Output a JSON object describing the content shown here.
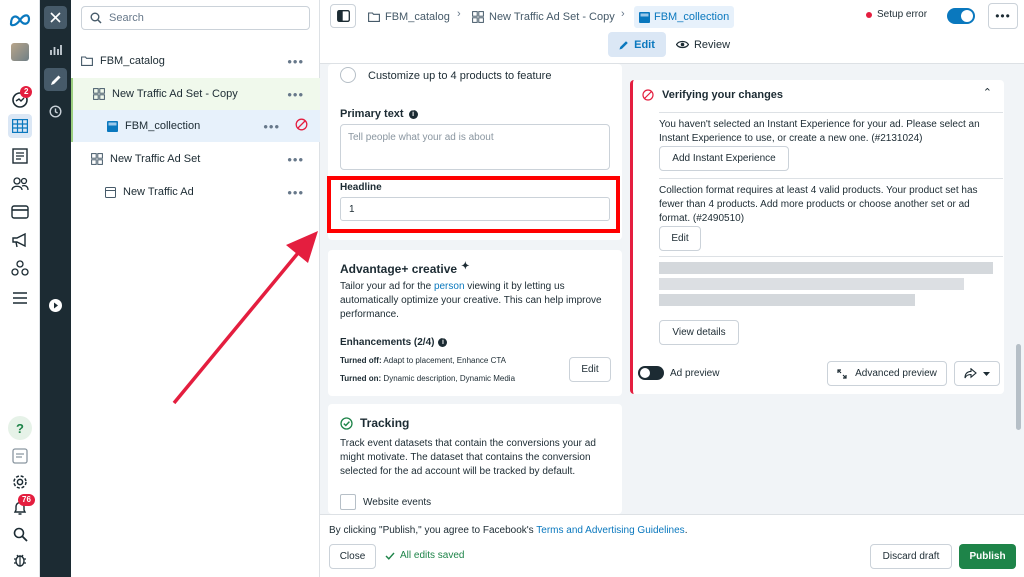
{
  "search": {
    "placeholder": "Search"
  },
  "notifications": {
    "messages_count": "2",
    "alerts_count": "76"
  },
  "tree": {
    "items": [
      {
        "label": "FBM_catalog"
      },
      {
        "label": "New Traffic Ad Set - Copy"
      },
      {
        "label": "FBM_collection"
      },
      {
        "label": "New Traffic Ad Set"
      },
      {
        "label": "New Traffic Ad"
      }
    ]
  },
  "breadcrumb": {
    "items": [
      "FBM_catalog",
      "New Traffic Ad Set - Copy",
      "FBM_collection"
    ]
  },
  "header": {
    "status": "Setup error",
    "tabs": {
      "edit": "Edit",
      "review": "Review"
    }
  },
  "form": {
    "customize_label": "Customize up to 4 products to feature",
    "primary_text": {
      "label": "Primary text",
      "placeholder": "Tell people what your ad is about"
    },
    "headline": {
      "label": "Headline",
      "value": "1"
    },
    "advantage": {
      "title": "Advantage+ creative",
      "desc_before": "Tailor your ad for the ",
      "desc_link": "person",
      "desc_after": " viewing it by letting us automatically optimize your creative. This can help improve performance.",
      "enhancements_label": "Enhancements (2/4)",
      "turned_off_label": "Turned off:",
      "turned_off_value": "Adapt to placement, Enhance CTA",
      "turned_on_label": "Turned on:",
      "turned_on_value": "Dynamic description, Dynamic Media",
      "edit_label": "Edit"
    },
    "tracking": {
      "title": "Tracking",
      "desc": "Track event datasets that contain the conversions your ad might motivate. The dataset that contains the conversion selected for the ad account will be tracked by default.",
      "website_events": "Website events"
    }
  },
  "verify": {
    "title": "Verifying your changes",
    "error1": "You haven't selected an Instant Experience for your ad. Please select an Instant Experience to use, or create a new one. (#2131024)",
    "error1_button": "Add Instant Experience",
    "error2": "Collection format requires at least 4 valid products. Your product set has fewer than 4 products. Add more products or choose another set or ad format. (#2490510)",
    "error2_button": "Edit",
    "view_details": "View details"
  },
  "preview": {
    "toggle_label": "Ad preview",
    "advanced": "Advanced preview"
  },
  "footer": {
    "notice_before": "By clicking \"Publish,\" you agree to Facebook's ",
    "notice_link": "Terms and Advertising Guidelines",
    "notice_after": ".",
    "close": "Close",
    "saved": "All edits saved",
    "discard": "Discard draft",
    "publish": "Publish"
  },
  "colors": {
    "accent": "#0a78be",
    "publish": "#1e8449",
    "error": "#e41e3f",
    "highlight": "#ff0000",
    "selected_row": "#e7f1fb"
  }
}
